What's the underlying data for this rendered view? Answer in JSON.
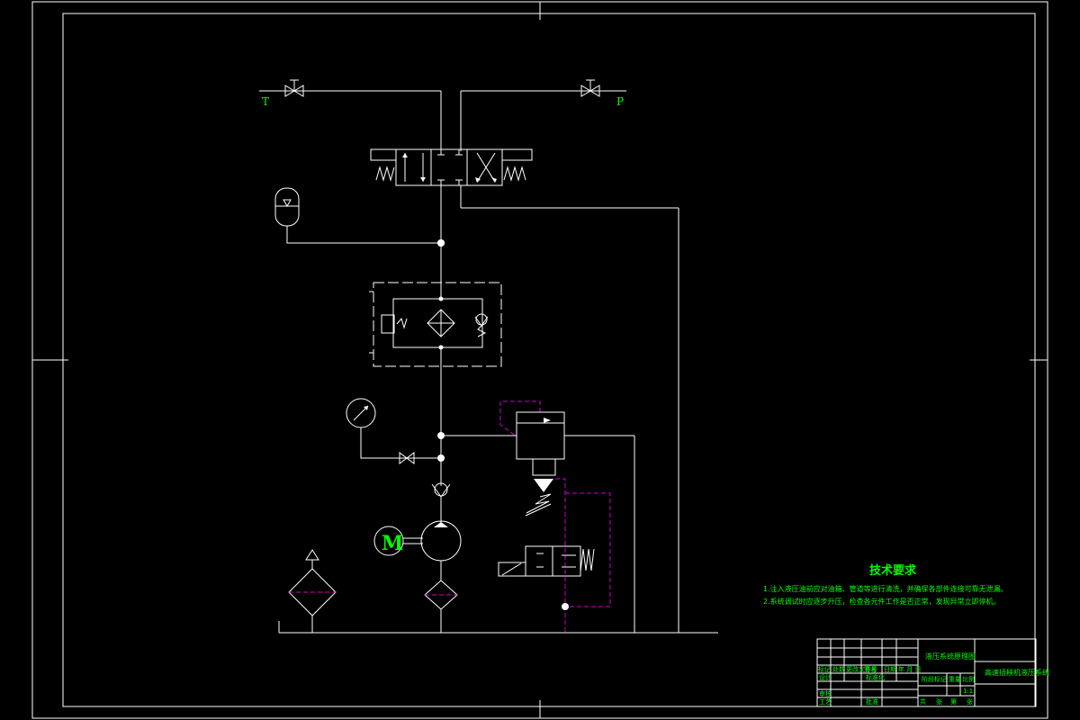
{
  "ports": {
    "tank": "T",
    "pressure": "P"
  },
  "motor": {
    "letter": "M"
  },
  "notes": {
    "title": "技术要求",
    "lines": [
      "1.注入液压油前应对油箱、管道等进行清洗，并确保各部件连接可靠无泄漏。",
      "2.系统调试时应逐步升压，检查各元件工作是否正常，发现异常立即停机。"
    ]
  },
  "title_block": {
    "drawing_name": "液压系统原理图",
    "project_name": "高速插秧机液压系统",
    "row_labels": [
      "标记",
      "设计",
      "审核",
      "工艺"
    ],
    "header_cells": [
      "标记",
      "处数",
      "更改文件号",
      "签名",
      "日期",
      "年 月 日"
    ],
    "mid_labels": [
      "标准化",
      "批准"
    ],
    "stage_labels": [
      "阶段标记",
      "重量",
      "比例"
    ],
    "scale": "1:1",
    "sheet_labels": [
      "共",
      "张",
      "第",
      "张"
    ]
  },
  "colors": {
    "line": "#ffffff",
    "text": "#00ff00",
    "pilot": "#d000d0",
    "background": "#000000"
  }
}
